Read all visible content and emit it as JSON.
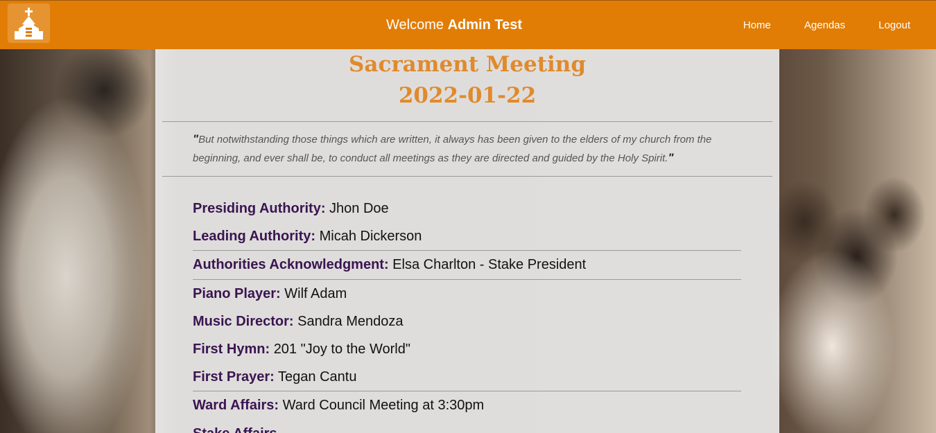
{
  "header": {
    "welcome_prefix": "Welcome",
    "user_name": "Admin Test",
    "nav": [
      {
        "label": "Home"
      },
      {
        "label": "Agendas"
      },
      {
        "label": "Logout"
      }
    ]
  },
  "meeting": {
    "title": "Sacrament Meeting",
    "date": "2022-01-22",
    "quote": "But notwithstanding those things which are written, it always has been given to the elders of my church from the beginning, and ever shall be, to conduct all meetings as they are directed and guided by the Holy Spirit.",
    "quote_open": "\"",
    "quote_close": "\"",
    "rows": [
      {
        "label": "Presiding Authority:",
        "value": "Jhon Doe"
      },
      {
        "label": "Leading Authority:",
        "value": "Micah Dickerson"
      },
      {
        "label": "Authorities Acknowledgment:",
        "value": "Elsa Charlton - Stake President"
      },
      {
        "label": "Piano Player:",
        "value": "Wilf Adam"
      },
      {
        "label": "Music Director:",
        "value": "Sandra Mendoza"
      },
      {
        "label": "First Hymn:",
        "value": "201 \"Joy to the World\""
      },
      {
        "label": "First Prayer:",
        "value": "Tegan Cantu"
      },
      {
        "label": "Ward Affairs:",
        "value": "Ward Council Meeting at 3:30pm"
      },
      {
        "label": "Stake Affairs",
        "value": ""
      }
    ]
  },
  "colors": {
    "header_bg": "#e17d05",
    "title": "#e08a2c",
    "label": "#3a1450"
  },
  "icons": {
    "logo": "church-icon"
  }
}
